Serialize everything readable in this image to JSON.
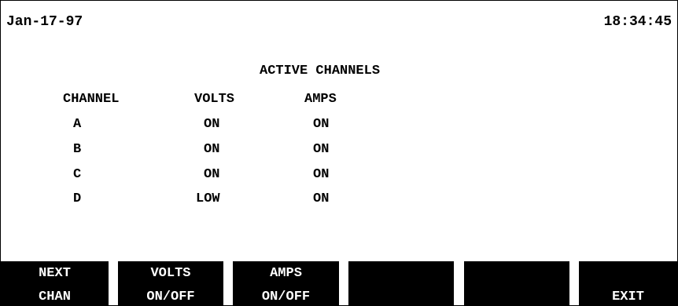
{
  "header": {
    "date": "Jan-17-97",
    "time": "18:34:45"
  },
  "title": "ACTIVE CHANNELS",
  "table": {
    "headers": [
      "CHANNEL",
      "VOLTS",
      "AMPS"
    ],
    "rows": [
      [
        "A",
        "ON",
        "ON"
      ],
      [
        "B",
        "ON",
        "ON"
      ],
      [
        "C",
        "ON",
        "ON"
      ],
      [
        "D",
        "LOW",
        "ON"
      ]
    ]
  },
  "softkeys": [
    {
      "line1": "NEXT",
      "line2": "CHAN"
    },
    {
      "line1": "VOLTS",
      "line2": "ON/OFF"
    },
    {
      "line1": "AMPS",
      "line2": "ON/OFF"
    },
    {
      "line1": "",
      "line2": ""
    },
    {
      "line1": "",
      "line2": ""
    },
    {
      "line1": "",
      "line2": "EXIT"
    }
  ],
  "colors": {
    "background": "#ffffff",
    "text": "#000000",
    "softkey_bg": "#000000",
    "softkey_text": "#ffffff"
  }
}
